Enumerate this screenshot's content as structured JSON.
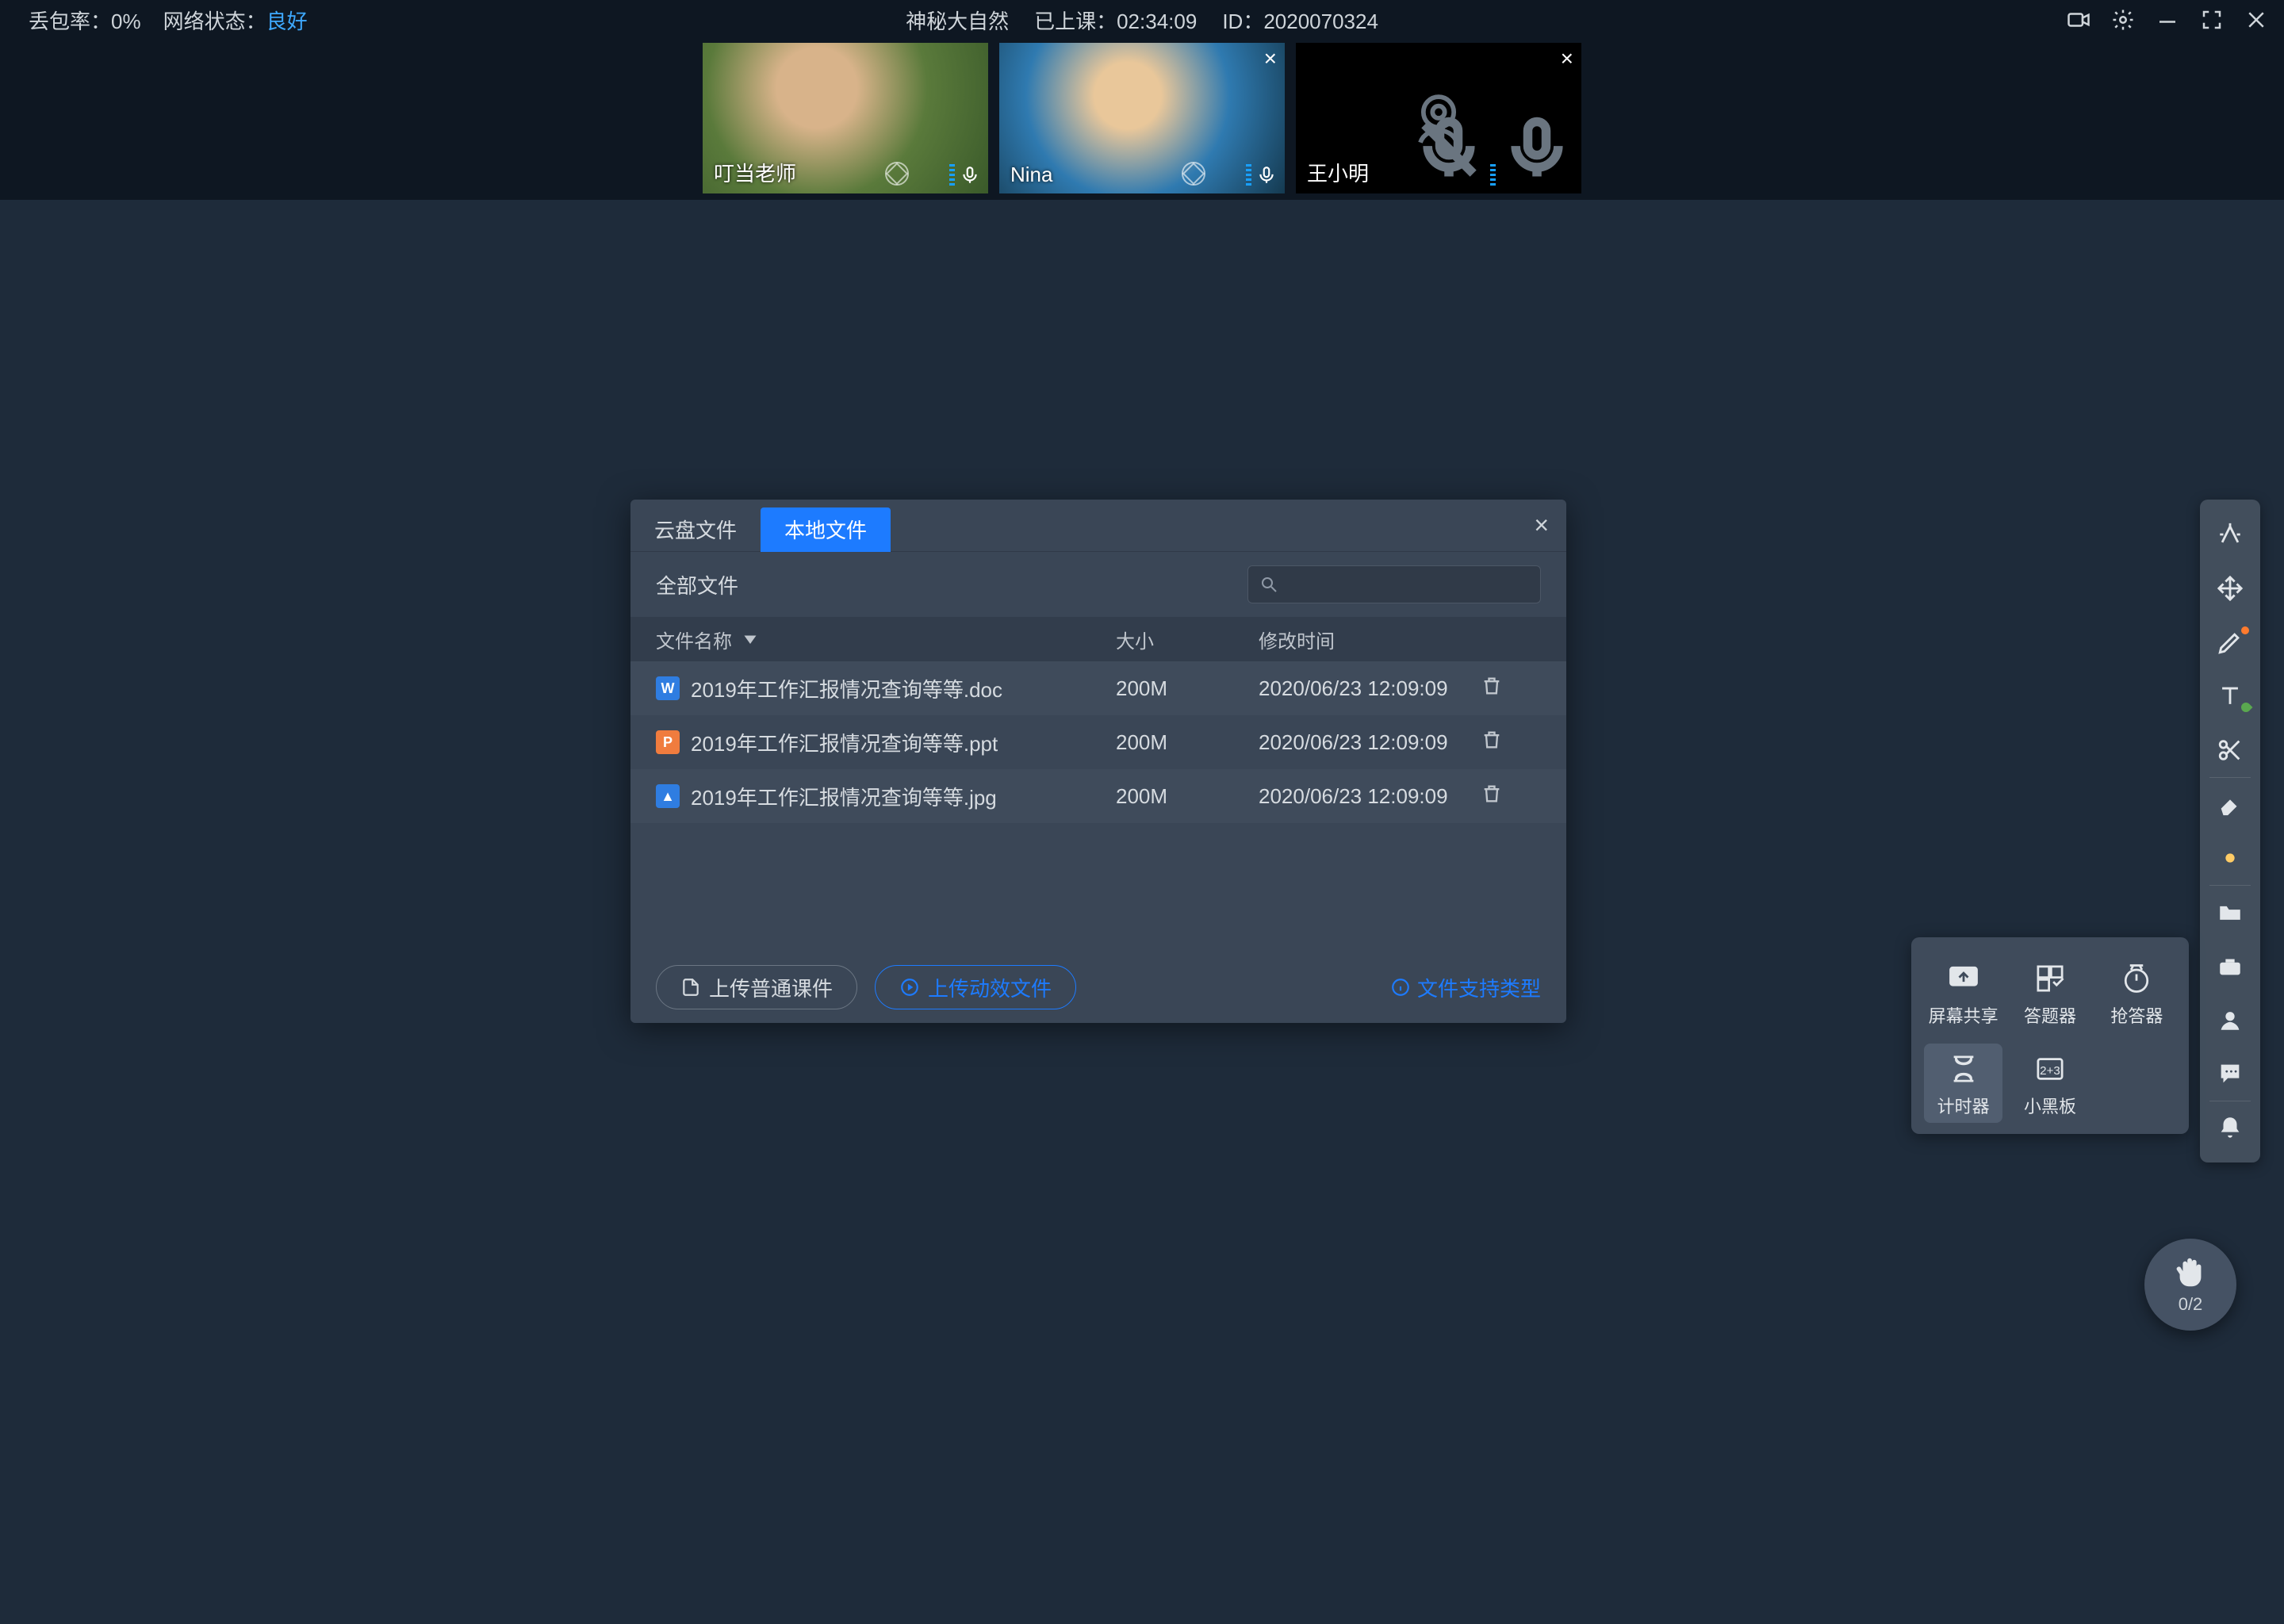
{
  "topbar": {
    "loss_label": "丢包率：",
    "loss_value": "0%",
    "net_label": "网络状态：",
    "net_value": "良好",
    "title": "神秘大自然",
    "duration_label": "已上课：",
    "duration_value": "02:34:09",
    "id_label": "ID：",
    "id_value": "2020070324"
  },
  "participants": [
    {
      "name": "叮当老师",
      "muted": false,
      "camera": true,
      "closable": false
    },
    {
      "name": "Nina",
      "muted": false,
      "camera": true,
      "closable": true
    },
    {
      "name": "王小明",
      "muted": true,
      "camera": false,
      "closable": true
    }
  ],
  "dialog": {
    "tab_cloud": "云盘文件",
    "tab_local": "本地文件",
    "filter_all": "全部文件",
    "col_name": "文件名称",
    "col_size": "大小",
    "col_mtime": "修改时间",
    "files": [
      {
        "icon": "W",
        "class": "f-w",
        "name": "2019年工作汇报情况查询等等.doc",
        "size": "200M",
        "mtime": "2020/06/23 12:09:09"
      },
      {
        "icon": "P",
        "class": "f-p",
        "name": "2019年工作汇报情况查询等等.ppt",
        "size": "200M",
        "mtime": "2020/06/23 12:09:09"
      },
      {
        "icon": "▲",
        "class": "f-i",
        "name": "2019年工作汇报情况查询等等.jpg",
        "size": "200M",
        "mtime": "2020/06/23 12:09:09"
      }
    ],
    "btn_upload_plain": "上传普通课件",
    "btn_upload_anim": "上传动效文件",
    "link_support": "文件支持类型"
  },
  "toolpanel": {
    "share": "屏幕共享",
    "answer": "答题器",
    "race": "抢答器",
    "timer": "计时器",
    "board": "小黑板"
  },
  "hand": {
    "count": "0/2"
  }
}
